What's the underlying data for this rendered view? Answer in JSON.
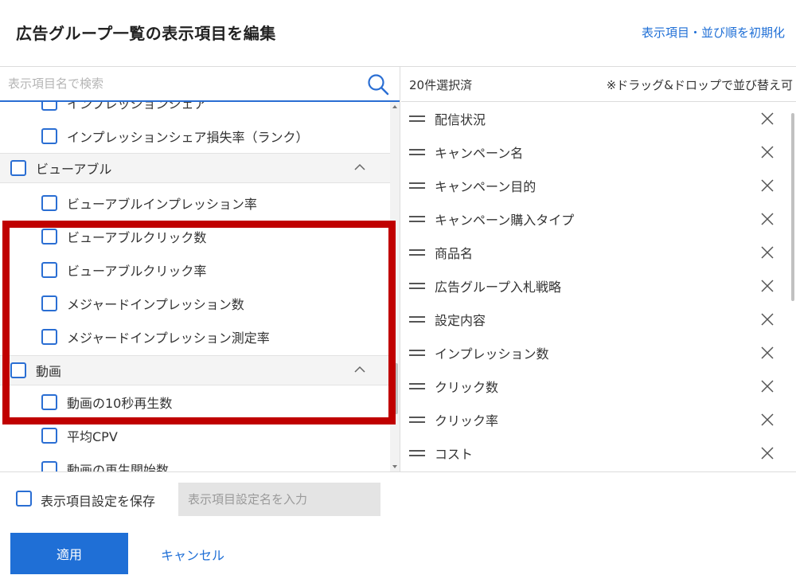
{
  "header": {
    "title": "広告グループ一覧の表示項目を編集",
    "reset_link": "表示項目・並び順を初期化"
  },
  "search": {
    "placeholder": "表示項目名で検索",
    "icon": "search-icon"
  },
  "left_tree": {
    "items": [
      {
        "type": "child",
        "label": "インプレッションシェア",
        "checked": false
      },
      {
        "type": "child",
        "label": "インプレッションシェア損失率（ランク）",
        "checked": false
      },
      {
        "type": "group",
        "label": "ビューアブル",
        "checked": false,
        "expanded": true
      },
      {
        "type": "child",
        "label": "ビューアブルインプレッション率",
        "checked": false
      },
      {
        "type": "child",
        "label": "ビューアブルクリック数",
        "checked": false
      },
      {
        "type": "child",
        "label": "ビューアブルクリック率",
        "checked": false
      },
      {
        "type": "child",
        "label": "メジャードインプレッション数",
        "checked": false
      },
      {
        "type": "child",
        "label": "メジャードインプレッション測定率",
        "checked": false
      },
      {
        "type": "group",
        "label": "動画",
        "checked": false,
        "expanded": true
      },
      {
        "type": "child",
        "label": "動画の10秒再生数",
        "checked": false
      },
      {
        "type": "child",
        "label": "平均CPV",
        "checked": false
      },
      {
        "type": "child",
        "label": "動画の再生開始数",
        "checked": false
      }
    ]
  },
  "right_panel": {
    "count": "20件選択済",
    "hint": "※ドラッグ&ドロップで並び替え可",
    "selected": [
      "配信状況",
      "キャンペーン名",
      "キャンペーン目的",
      "キャンペーン購入タイプ",
      "商品名",
      "広告グループ入札戦略",
      "設定内容",
      "インプレッション数",
      "クリック数",
      "クリック率",
      "コスト"
    ]
  },
  "footer": {
    "save_label": "表示項目設定を保存",
    "name_placeholder": "表示項目設定名を入力",
    "apply_label": "適用",
    "cancel_label": "キャンセル"
  },
  "colors": {
    "accent": "#1f6fd6",
    "highlight": "#c00000"
  }
}
